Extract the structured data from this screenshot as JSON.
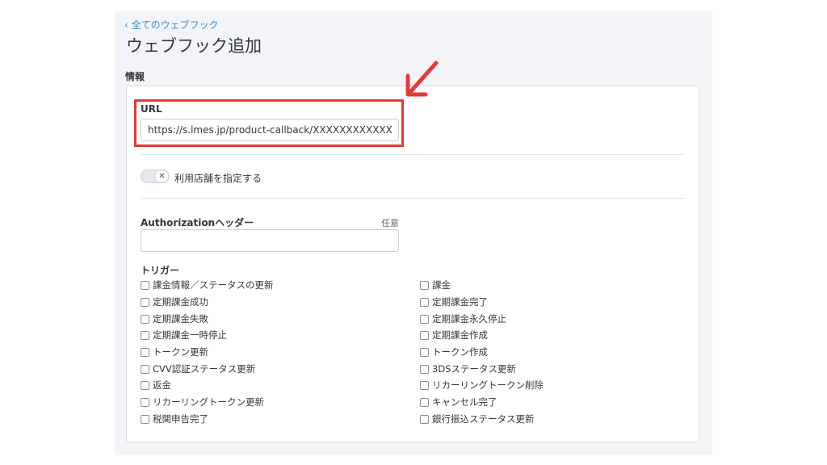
{
  "nav": {
    "back_label": "‹ 全てのウェブフック"
  },
  "page": {
    "title": "ウェブフック追加",
    "section": "情報"
  },
  "url_field": {
    "label": "URL",
    "value": "https://s.lmes.jp/product-callback/XXXXXXXXXXXX"
  },
  "store_toggle": {
    "label": "利用店舗を指定する",
    "state": "off",
    "knob_glyph": "✕"
  },
  "auth_field": {
    "label": "Authorizationヘッダー",
    "optional": "任意",
    "value": ""
  },
  "triggers": {
    "heading": "トリガー",
    "left": [
      "課金情報／ステータスの更新",
      "定期課金成功",
      "定期課金失敗",
      "定期課金一時停止",
      "トークン更新",
      "CVV認証ステータス更新",
      "返金",
      "リカーリングトークン更新",
      "税関申告完了"
    ],
    "right": [
      "課金",
      "定期課金完了",
      "定期課金永久停止",
      "定期課金作成",
      "トークン作成",
      "3DSステータス更新",
      "リカーリングトークン削除",
      "キャンセル完了",
      "銀行振込ステータス更新"
    ]
  },
  "colors": {
    "highlight": "#e53935",
    "link": "#3f86c8",
    "panel_bg": "#f2f4f7"
  }
}
